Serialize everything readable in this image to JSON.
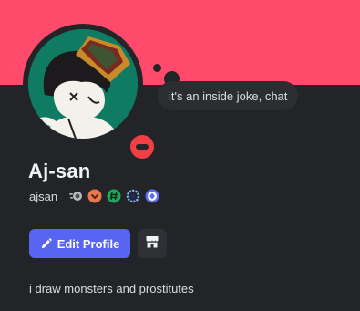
{
  "profile": {
    "display_name": "Aj-san",
    "username": "ajsan",
    "status": "do-not-disturb",
    "custom_status": "it's an inside joke, chat",
    "bio": "i draw monsters and prostitutes",
    "banner_color": "#ff4a6b",
    "badges": [
      "nitro-icon",
      "boost-icon",
      "hashtag-quest-icon",
      "gem-ring-icon",
      "diamond-icon"
    ]
  },
  "actions": {
    "edit_profile_label": "Edit Profile",
    "shop_icon": "shop-icon"
  },
  "colors": {
    "accent": "#5865f2",
    "dnd_red": "#f23f43",
    "background": "#232428"
  }
}
